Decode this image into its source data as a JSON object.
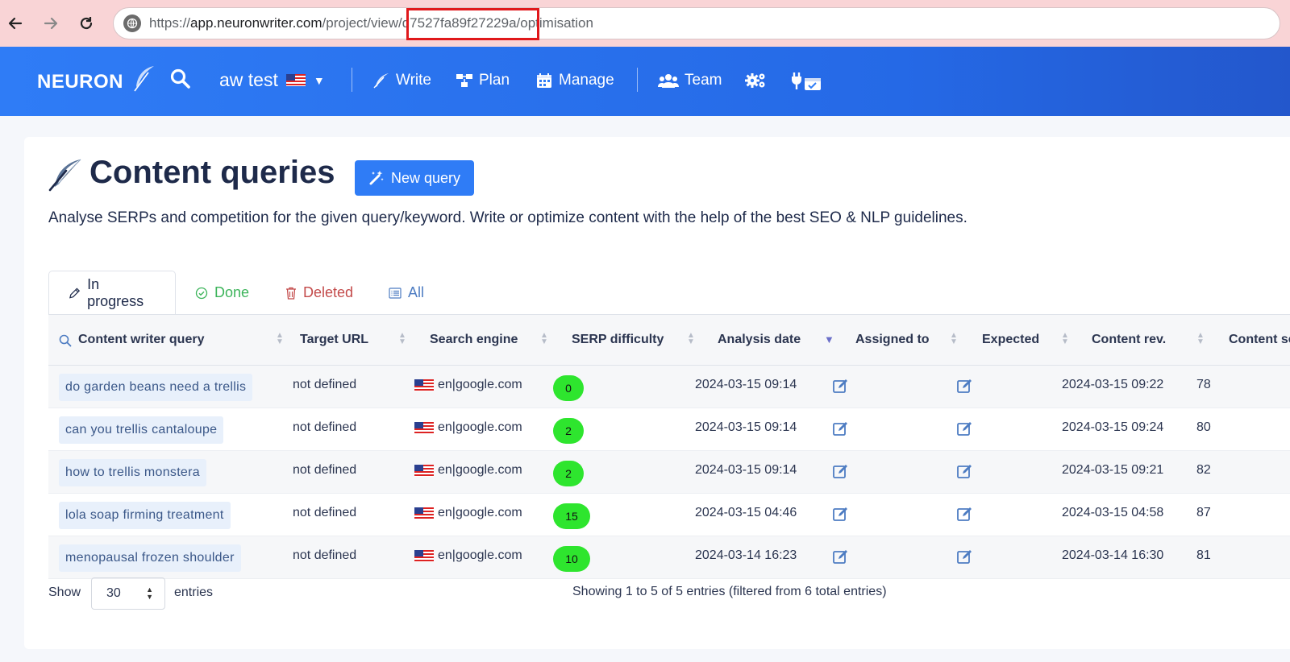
{
  "browser": {
    "url_scheme": "https://",
    "url_host": "app.neuronwriter.com",
    "url_path": "/project/view/d7527fa89f27229a/optimisation"
  },
  "header": {
    "logo": "NEURON",
    "project_name": "aw test",
    "nav": {
      "write": "Write",
      "plan": "Plan",
      "manage": "Manage",
      "team": "Team"
    }
  },
  "page": {
    "title": "Content queries",
    "new_query_label": "New query",
    "subtitle": "Analyse SERPs and competition for the given query/keyword. Write or optimize content with the help of the best SEO & NLP guidelines."
  },
  "tabs": {
    "in_progress": "In progress",
    "done": "Done",
    "deleted": "Deleted",
    "all": "All"
  },
  "columns": {
    "query": "Content writer query",
    "target_url": "Target URL",
    "search_engine": "Search engine",
    "serp_difficulty": "SERP difficulty",
    "analysis_date": "Analysis date",
    "assigned_to": "Assigned to",
    "expected": "Expected",
    "content_rev": "Content rev.",
    "content_score": "Content sc"
  },
  "rows": [
    {
      "query": "do garden beans need a trellis",
      "target_url": "not defined",
      "engine": "en|google.com",
      "difficulty": "0",
      "analysis_date": "2024-03-15 09:14",
      "content_rev": "2024-03-15 09:22",
      "score": "78"
    },
    {
      "query": "can you trellis cantaloupe",
      "target_url": "not defined",
      "engine": "en|google.com",
      "difficulty": "2",
      "analysis_date": "2024-03-15 09:14",
      "content_rev": "2024-03-15 09:24",
      "score": "80"
    },
    {
      "query": "how to trellis monstera",
      "target_url": "not defined",
      "engine": "en|google.com",
      "difficulty": "2",
      "analysis_date": "2024-03-15 09:14",
      "content_rev": "2024-03-15 09:21",
      "score": "82"
    },
    {
      "query": "lola soap firming treatment",
      "target_url": "not defined",
      "engine": "en|google.com",
      "difficulty": "15",
      "analysis_date": "2024-03-15 04:46",
      "content_rev": "2024-03-15 04:58",
      "score": "87"
    },
    {
      "query": "menopausal frozen shoulder",
      "target_url": "not defined",
      "engine": "en|google.com",
      "difficulty": "10",
      "analysis_date": "2024-03-14 16:23",
      "content_rev": "2024-03-14 16:30",
      "score": "81"
    }
  ],
  "footer": {
    "show_label": "Show",
    "entries_value": "30",
    "entries_label": "entries",
    "info": "Showing 1 to 5 of 5 entries (filtered from 6 total entries)"
  },
  "colors": {
    "brand_blue": "#2f7cf6",
    "difficulty_green": "#2ee52e",
    "url_highlight": "#e0181b"
  }
}
